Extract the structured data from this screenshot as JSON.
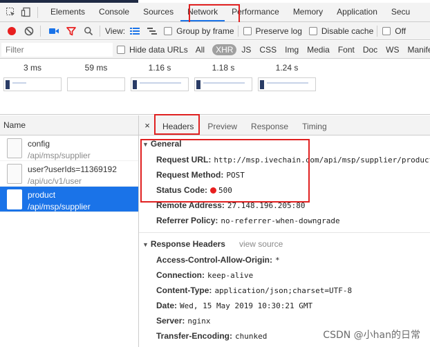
{
  "tabs": [
    "Elements",
    "Console",
    "Sources",
    "Network",
    "Performance",
    "Memory",
    "Application",
    "Secu"
  ],
  "toolbar": {
    "view_label": "View:",
    "group_by_frame": "Group by frame",
    "preserve_log": "Preserve log",
    "disable_cache": "Disable cache",
    "offline": "Off"
  },
  "filter": {
    "placeholder": "Filter",
    "hide_data_urls": "Hide data URLs",
    "types": [
      "All",
      "XHR",
      "JS",
      "CSS",
      "Img",
      "Media",
      "Font",
      "Doc",
      "WS",
      "Manifest"
    ]
  },
  "filmstrip": [
    "3 ms",
    "59 ms",
    "1.16 s",
    "1.18 s",
    "1.24 s"
  ],
  "list": {
    "header": "Name",
    "requests": [
      {
        "name": "config",
        "path": "/api/msp/supplier"
      },
      {
        "name": "user?userIds=11369192",
        "path": "/api/uc/v1/user"
      },
      {
        "name": "product",
        "path": "/api/msp/supplier"
      }
    ]
  },
  "detail": {
    "close": "×",
    "tabs": [
      "Headers",
      "Preview",
      "Response",
      "Timing"
    ],
    "general": {
      "title": "General",
      "rows": [
        {
          "key": "Request URL:",
          "value": "http://msp.ivechain.com/api/msp/supplier/product"
        },
        {
          "key": "Request Method:",
          "value": "POST"
        },
        {
          "key": "Status Code:",
          "value": "500"
        },
        {
          "key": "Remote Address:",
          "value": "27.148.196.205:80"
        },
        {
          "key": "Referrer Policy:",
          "value": "no-referrer-when-downgrade"
        }
      ]
    },
    "response_headers": {
      "title": "Response Headers",
      "view_source": "view source",
      "rows": [
        {
          "key": "Access-Control-Allow-Origin:",
          "value": "*"
        },
        {
          "key": "Connection:",
          "value": "keep-alive"
        },
        {
          "key": "Content-Type:",
          "value": "application/json;charset=UTF-8"
        },
        {
          "key": "Date:",
          "value": "Wed, 15 May 2019 10:30:21 GMT"
        },
        {
          "key": "Server:",
          "value": "nginx"
        },
        {
          "key": "Transfer-Encoding:",
          "value": "chunked"
        }
      ]
    }
  },
  "watermark": "CSDN @小han的日常",
  "colors": {
    "accent": "#1a73e8",
    "highlight_box": "#e02020",
    "record": "#e81f1f",
    "status_error": "#e81f1f"
  },
  "icons": [
    "inspect-icon",
    "device-toggle-icon",
    "record-icon",
    "clear-icon",
    "video-icon",
    "filter-icon",
    "search-icon",
    "list-view-icon",
    "waterfall-view-icon"
  ]
}
